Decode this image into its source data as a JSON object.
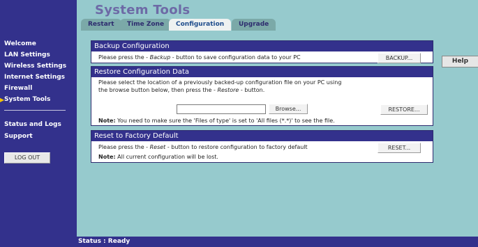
{
  "header": {
    "title": "System Tools",
    "tabs": [
      {
        "label": "Restart"
      },
      {
        "label": "Time Zone"
      },
      {
        "label": "Configuration"
      },
      {
        "label": "Upgrade"
      }
    ],
    "active_tab": "Configuration"
  },
  "sidebar": {
    "items": [
      {
        "label": "Welcome"
      },
      {
        "label": "LAN Settings"
      },
      {
        "label": "Wireless Settings"
      },
      {
        "label": "Internet Settings"
      },
      {
        "label": "Firewall"
      },
      {
        "label": "System Tools"
      },
      {
        "label": "Status and Logs"
      },
      {
        "label": "Support"
      }
    ],
    "active_item": "System Tools",
    "logout_label": "LOG OUT"
  },
  "help": {
    "label": "Help"
  },
  "backup": {
    "heading": "Backup Configuration",
    "text_pre": "Please press the - ",
    "text_em": "Backup",
    "text_post": " - button to save configuration data to your PC",
    "button": "BACKUP..."
  },
  "restore": {
    "heading": "Restore Configuration Data",
    "line1": "Please select the location of a previously backed-up configuration file on your PC using",
    "line2_pre": "the browse button below, then press the - ",
    "line2_em": "Restore",
    "line2_post": " - button.",
    "file_value": "",
    "browse_button": "Browse...",
    "restore_button": "RESTORE...",
    "note_label": "Note:",
    "note_text": " You need to make sure the 'Files of type' is set to 'All files (*.*)' to see the file."
  },
  "reset": {
    "heading": "Reset to Factory Default",
    "text_pre": "Please press the - ",
    "text_em": "Reset",
    "text_post": " - button to restore configuration to factory default",
    "button": "RESET...",
    "note_label": "Note:",
    "note_text": " All current configuration will be lost."
  },
  "status": {
    "text": "Status : Ready"
  },
  "colors": {
    "sidebar": "#33318c",
    "background": "#96cacd",
    "panel_header": "#33318c",
    "title": "#6d6aa6"
  }
}
